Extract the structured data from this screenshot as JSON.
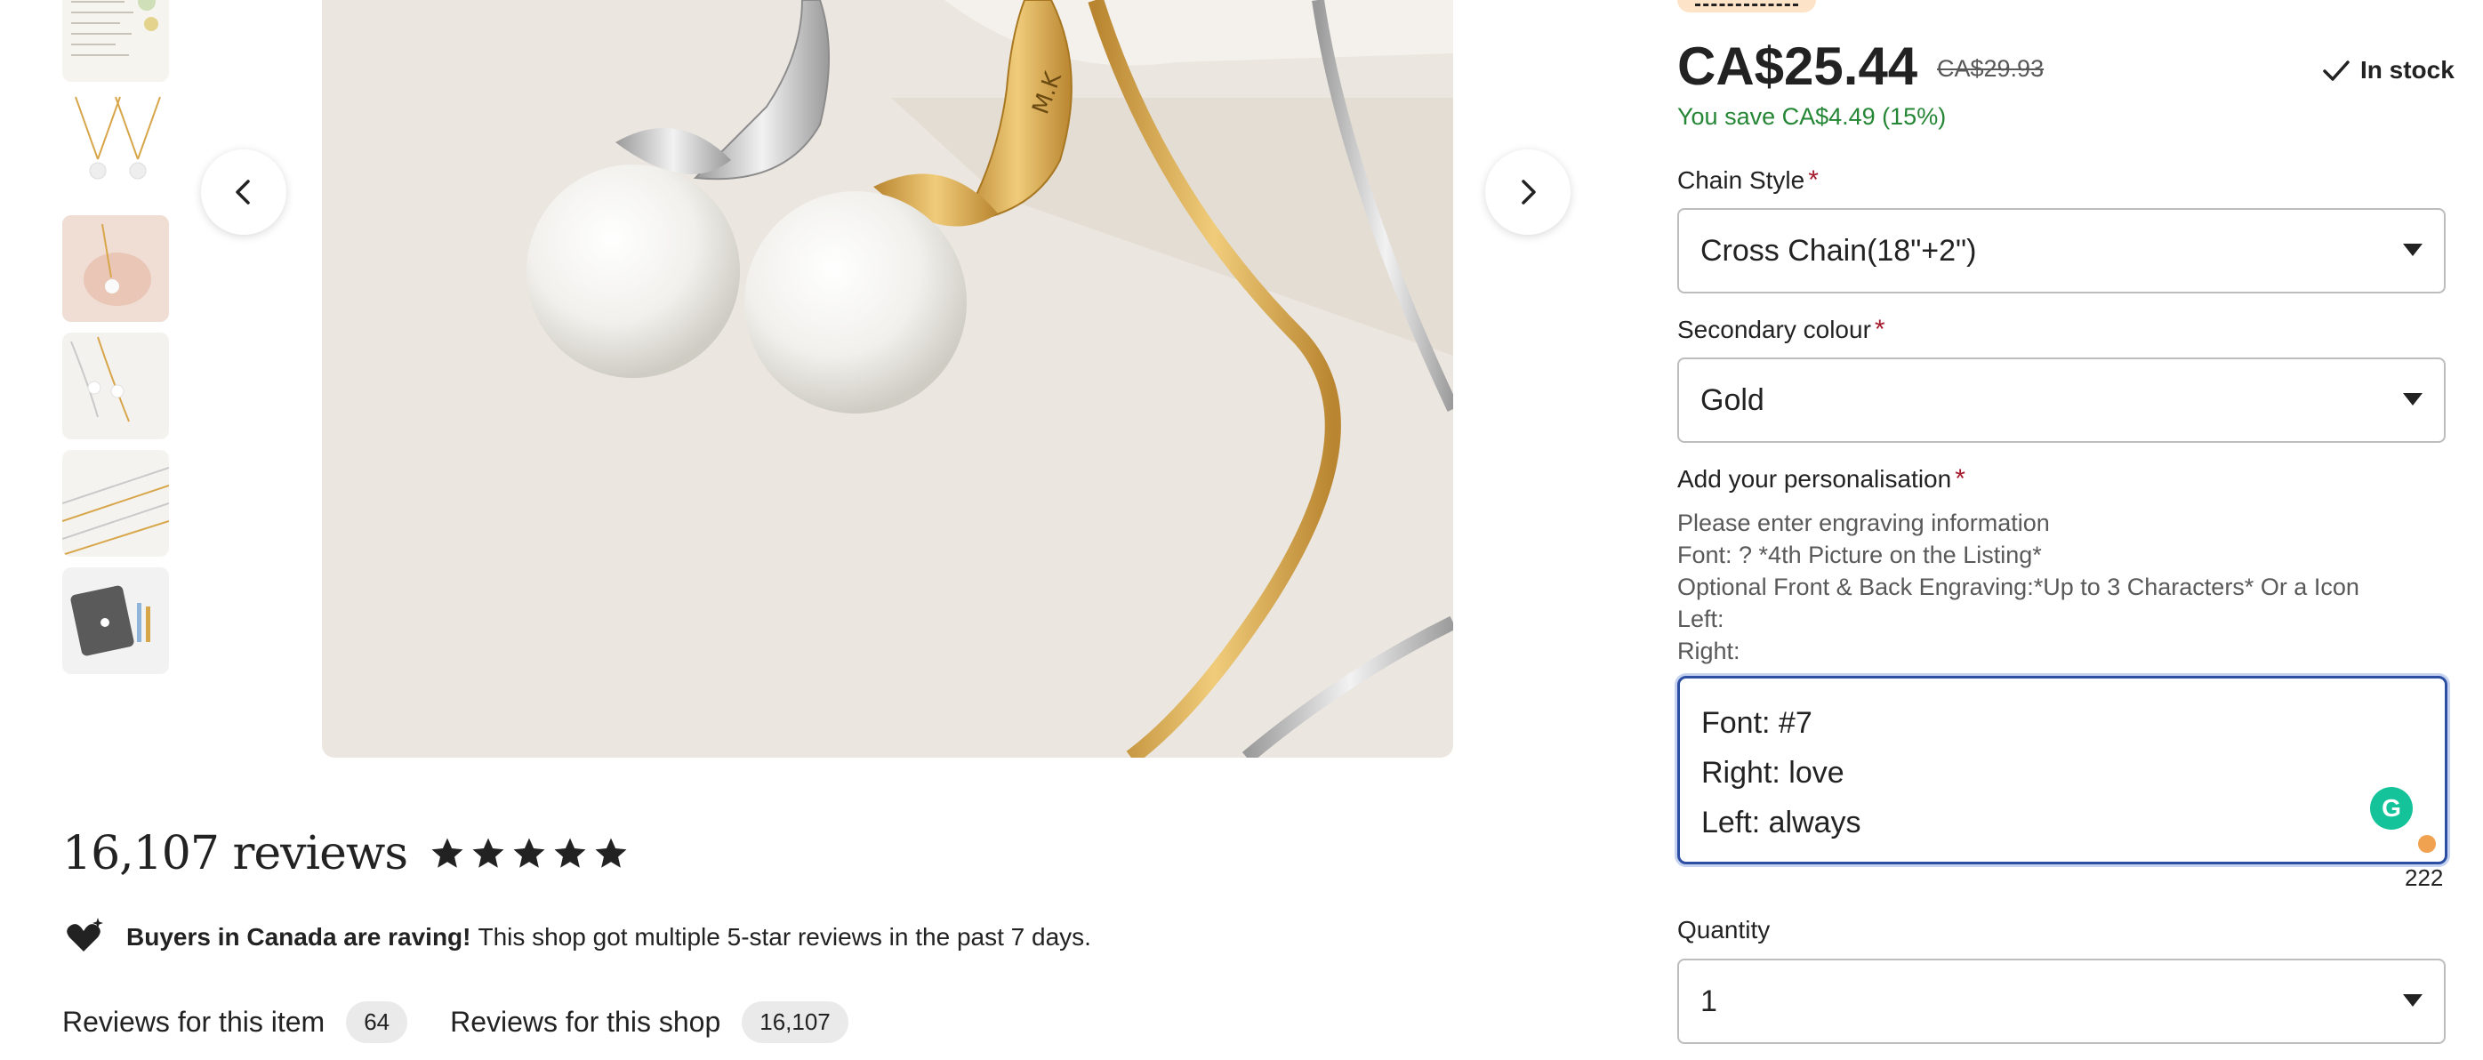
{
  "gallery": {
    "prev_label": "Previous image",
    "next_label": "Next image",
    "thumbnails": [
      {
        "icon": "certificate-thumbnail"
      },
      {
        "icon": "two-necklaces-thumbnail"
      },
      {
        "icon": "hand-holding-necklace-thumbnail"
      },
      {
        "icon": "necklaces-on-display-thumbnail"
      },
      {
        "icon": "chain-styles-thumbnail"
      },
      {
        "icon": "gift-box-thumbnail"
      }
    ],
    "engraving_text": "M.K"
  },
  "reviews": {
    "count_text": "16,107 reviews",
    "rating": 5,
    "raving_bold": "Buyers in Canada are raving!",
    "raving_text": "This shop got multiple 5-star reviews in the past 7 days.",
    "tabs": [
      {
        "label": "Reviews for this item",
        "count": "64"
      },
      {
        "label": "Reviews for this shop",
        "count": "16,107"
      }
    ]
  },
  "product": {
    "price": "CA$25.44",
    "original_price": "CA$29.93",
    "savings": "You save CA$4.49 (15%)",
    "stock": "In stock"
  },
  "options": {
    "chain_style": {
      "label": "Chain Style",
      "required": "*",
      "value": "Cross Chain(18\"+2\")"
    },
    "secondary_colour": {
      "label": "Secondary colour",
      "required": "*",
      "value": "Gold"
    },
    "personalisation": {
      "label": "Add your personalisation",
      "required": "*",
      "instructions": [
        "Please enter engraving information",
        "Font: ? *4th Picture on the Listing*",
        "Optional Front & Back Engraving:*Up to 3 Characters* Or a Icon",
        "Left:",
        "Right:"
      ],
      "lines": [
        "Font: #7",
        "Right: love",
        "Left: always"
      ],
      "remaining_chars": "222",
      "grammarly_letter": "G"
    },
    "quantity": {
      "label": "Quantity",
      "value": "1"
    }
  },
  "colors": {
    "accent_focus": "#2c4fa3",
    "savings_green": "#258635",
    "required_red": "#a61a2e",
    "badge_peach": "#fde4c8",
    "gold": "#d8a64a",
    "silver": "#c9c9c9"
  }
}
